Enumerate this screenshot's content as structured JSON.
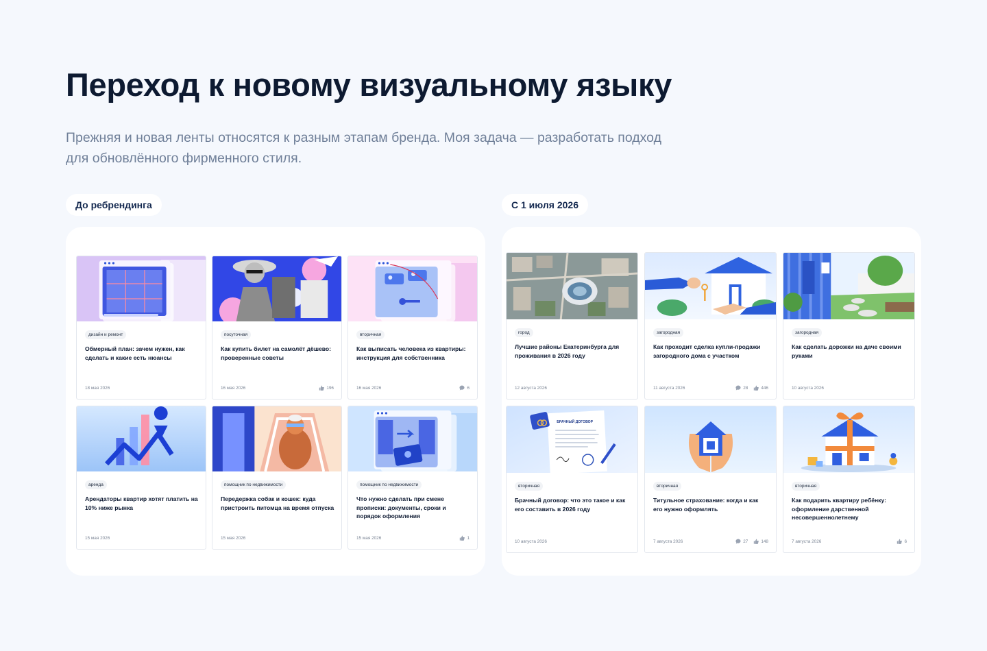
{
  "page": {
    "title": "Переход к новому визуальному языку",
    "subtitle": "Прежняя и новая ленты относятся к разным этапам бренда. Моя задача — разработать подход для обновлённого фирменного стиля."
  },
  "before": {
    "label": "До ребрендинга",
    "cards": [
      {
        "tag": "дизайн и ремонт",
        "title": "Обмерный план: зачем нужен, как сделать и какие есть нюансы",
        "date": "18 мая 2026",
        "comments": "",
        "likes": "",
        "image": "floor-plan-illustration"
      },
      {
        "tag": "посуточная",
        "title": "Как купить билет на самолёт дёшево: проверенные советы",
        "date": "16 мая 2026",
        "comments": "",
        "likes": "196",
        "image": "traveler-collage"
      },
      {
        "tag": "вторичная",
        "title": "Как выписать человека из квартиры: инструкция для собственника",
        "date": "16 мая 2026",
        "comments": "6",
        "likes": "",
        "image": "documents-keys-illustration"
      },
      {
        "tag": "аренда",
        "title": "Арендаторы квартир хотят платить на 10% ниже рынка",
        "date": "15 мая 2026",
        "comments": "",
        "likes": "",
        "image": "chart-illustration"
      },
      {
        "tag": "помощник по недвижимости",
        "title": "Передержка собак и кошек: куда пристроить питомца на время отпуска",
        "date": "15 мая 2026",
        "comments": "",
        "likes": "",
        "image": "dog-illustration"
      },
      {
        "tag": "помощник по недвижимости",
        "title": "Что нужно сделать при смене прописки: документы, сроки и порядок оформления",
        "date": "15 мая 2026",
        "comments": "",
        "likes": "1",
        "image": "passport-illustration"
      }
    ]
  },
  "after": {
    "label": "С 1 июля 2026",
    "cards": [
      {
        "tag": "город",
        "title": "Лучшие районы Екатеринбурга для проживания в 2026 году",
        "date": "12 августа 2026",
        "comments": "",
        "likes": "",
        "image": "city-aerial-photo"
      },
      {
        "tag": "загородная",
        "title": "Как проходит сделка купли-продажи загородного дома с участком",
        "date": "11 августа 2026",
        "comments": "28",
        "likes": "446",
        "image": "key-handover-illustration"
      },
      {
        "tag": "загородная",
        "title": "Как сделать дорожки на даче своими руками",
        "date": "10 августа 2026",
        "comments": "",
        "likes": "",
        "image": "garden-path-illustration"
      },
      {
        "tag": "вторичная",
        "title": "Брачный договор: что это такое и как его составить в 2026 году",
        "date": "10 августа 2026",
        "comments": "",
        "likes": "",
        "image": "marriage-contract-illustration",
        "doc_heading": "БРАЧНЫЙ ДОГОВОР"
      },
      {
        "tag": "вторичная",
        "title": "Титульное страхование: когда и как его нужно оформлять",
        "date": "7 августа 2026",
        "comments": "27",
        "likes": "148",
        "image": "hands-house-illustration"
      },
      {
        "tag": "вторичная",
        "title": "Как подарить квартиру ребёнку: оформление дарственной несовершеннолетнему",
        "date": "7 августа 2026",
        "comments": "",
        "likes": "6",
        "image": "gift-house-illustration"
      }
    ]
  },
  "colors": {
    "background": "#f5f8fd",
    "brand_blue": "#1f4ed8",
    "title": "#0d1a31",
    "muted": "#6f7f98"
  }
}
